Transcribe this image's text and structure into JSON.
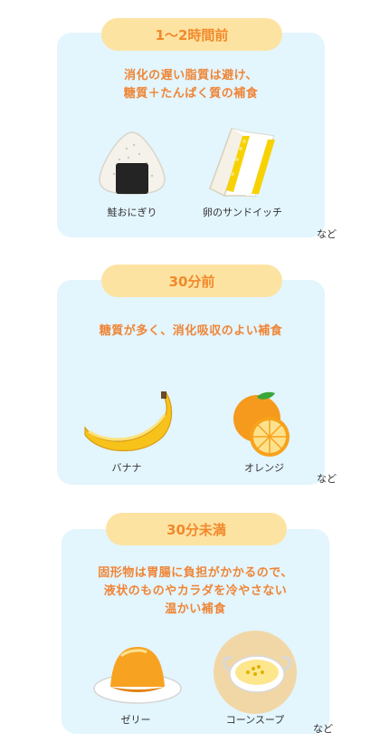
{
  "sections": [
    {
      "heading": "1～2時間前",
      "desc_lines": [
        "消化の遅い脂質は避け、",
        "糖質＋たんぱく質の補食"
      ],
      "foods": [
        {
          "label": "鮭おにぎり",
          "icon": "onigiri-icon"
        },
        {
          "label": "卵のサンドイッチ",
          "icon": "sandwich-icon"
        }
      ],
      "etc": "など"
    },
    {
      "heading": "30分前",
      "desc_lines": [
        "糖質が多く、消化吸収のよい補食"
      ],
      "foods": [
        {
          "label": "バナナ",
          "icon": "banana-icon"
        },
        {
          "label": "オレンジ",
          "icon": "orange-icon"
        }
      ],
      "etc": "など"
    },
    {
      "heading": "30分未満",
      "desc_lines": [
        "固形物は胃腸に負担がかかるので、",
        "液状のものやカラダを冷やさない",
        "温かい補食"
      ],
      "foods": [
        {
          "label": "ゼリー",
          "icon": "jelly-icon"
        },
        {
          "label": "コーンスープ",
          "icon": "corn-soup-icon"
        }
      ],
      "etc": "など"
    }
  ],
  "colors": {
    "card": "#e3f5fd",
    "pill": "#fde3a2",
    "accent": "#ef8536"
  }
}
